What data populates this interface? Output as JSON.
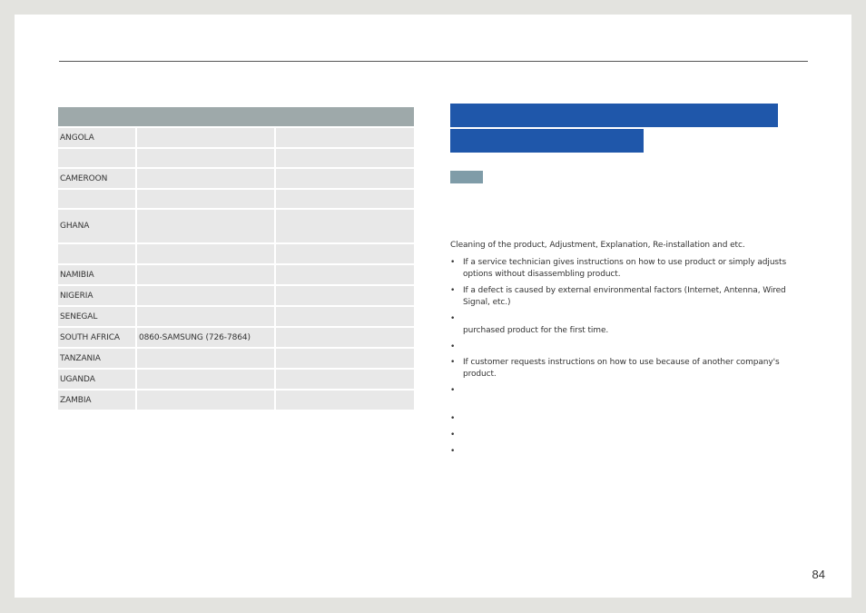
{
  "table": {
    "rows": [
      {
        "country": "ANGOLA",
        "phone": "",
        "web": ""
      },
      {
        "country": "",
        "phone": "",
        "web": ""
      },
      {
        "country": "CAMEROON",
        "phone": "",
        "web": ""
      },
      {
        "country": "",
        "phone": "",
        "web": ""
      },
      {
        "country": "GHANA",
        "phone": "",
        "web": ""
      },
      {
        "country": "",
        "phone": "",
        "web": ""
      },
      {
        "country": "NAMIBIA",
        "phone": "",
        "web": ""
      },
      {
        "country": "NIGERIA",
        "phone": "",
        "web": ""
      },
      {
        "country": "SENEGAL",
        "phone": "",
        "web": ""
      },
      {
        "country": "SOUTH AFRICA",
        "phone": "0860-SAMSUNG (726-7864)",
        "web": ""
      },
      {
        "country": "TANZANIA",
        "phone": "",
        "web": ""
      },
      {
        "country": "UGANDA",
        "phone": "",
        "web": ""
      },
      {
        "country": "ZAMBIA",
        "phone": "",
        "web": ""
      }
    ]
  },
  "right": {
    "intro": "Cleaning of the product, Adjustment, Explanation, Re-installation and etc.",
    "bullets": [
      "If a service technician gives instructions on how to use product or simply adjusts options without disassembling product.",
      "If a defect is caused by external environmental factors (Internet, Antenna, Wired Signal, etc.)",
      "purchased product for the first time.",
      "",
      "If customer requests instructions on how to use because of another company's product.",
      "",
      "",
      "",
      ""
    ]
  },
  "footer": {
    "page_number": "84"
  },
  "colors": {
    "table_header": "#9ea9aa",
    "table_cell": "#e8e8e8",
    "heading_bar": "#1f57aa",
    "tag": "#7f9ca8"
  }
}
